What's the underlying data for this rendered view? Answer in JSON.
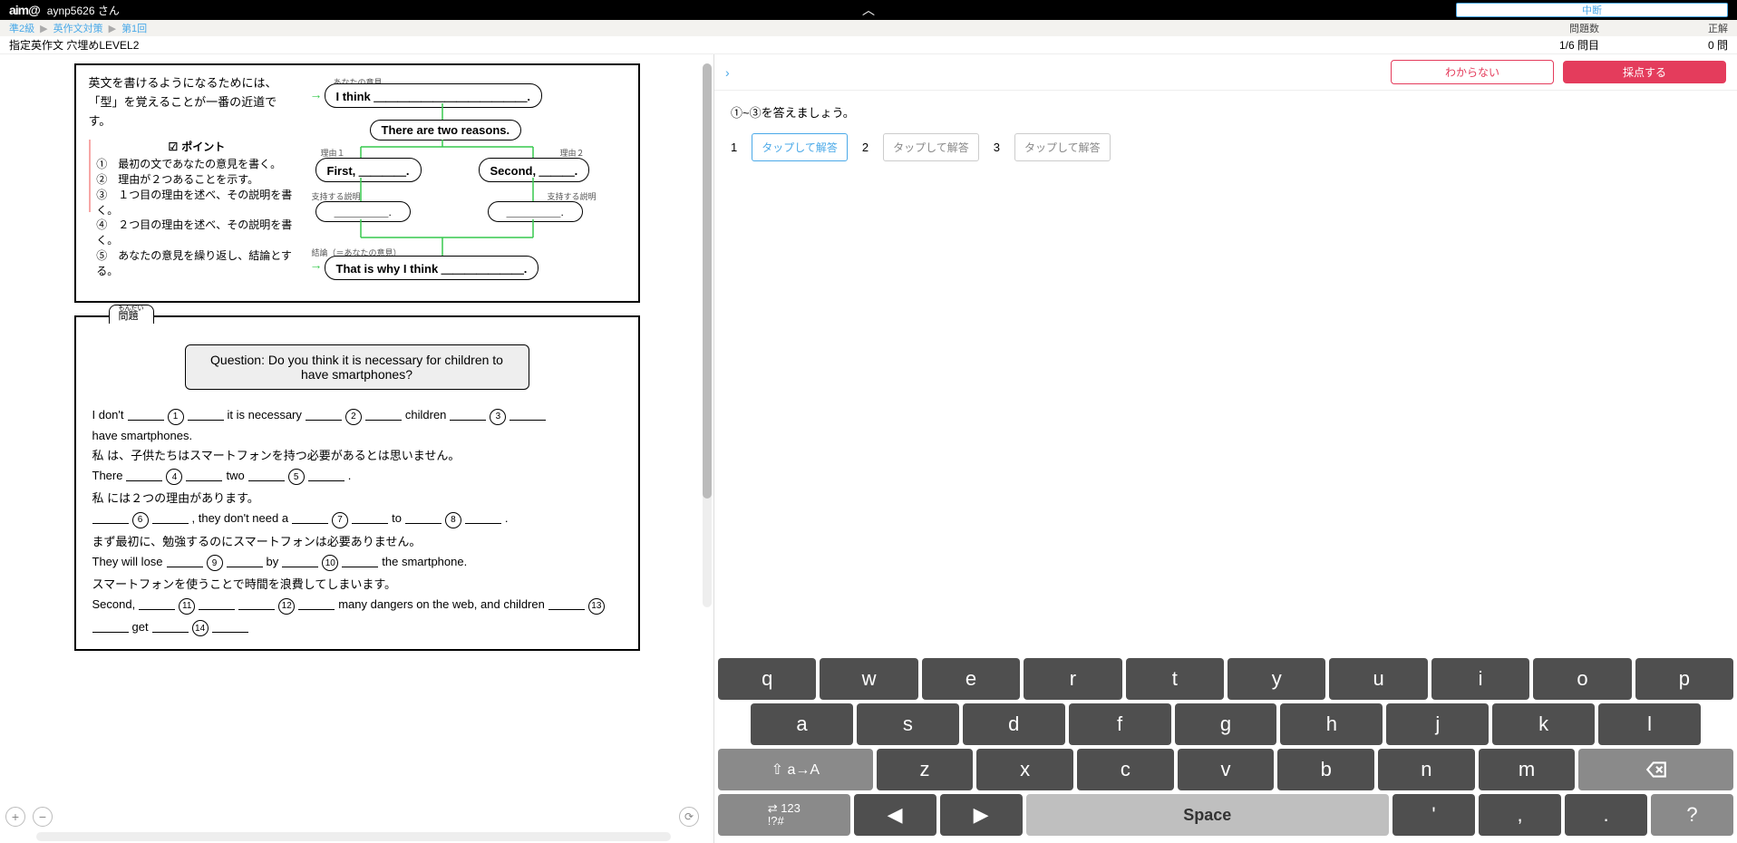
{
  "topbar": {
    "logo": "aim@",
    "user": "aynp5626 さん",
    "interrupt": "中断"
  },
  "breadcrumb": {
    "l1": "準2級",
    "l2": "英作文対策",
    "l3": "第1回",
    "counter_label": "問題数",
    "correct_label": "正解"
  },
  "title": {
    "text": "指定英作文 穴埋めLEVEL2",
    "counter_val": "1/6 問目",
    "correct_val": "0 問"
  },
  "explain": {
    "line1": "英文を書けるようになるためには、",
    "line2": "「型」を覚えることが一番の近道です。",
    "point_h": "ポイント",
    "pts": [
      "①　最初の文であなたの意見を書く。",
      "②　理由が２つあることを示す。",
      "③　１つ目の理由を述べ、その説明を書く。",
      "④　２つ目の理由を述べ、その説明を書く。",
      "⑤　あなたの意見を繰り返し、結論とする。"
    ]
  },
  "flow": {
    "opinion_l": "あなたの意見",
    "b1": "I think ＿＿＿＿＿＿＿＿＿＿＿＿＿.",
    "b2": "There are two reasons.",
    "r1_l": "理由１",
    "r2_l": "理由２",
    "b3": "First, ＿＿＿＿.",
    "b4": "Second, ＿＿＿.",
    "s1_l": "支持する説明",
    "s2_l": "支持する説明",
    "b5": "＿＿＿＿＿.",
    "b6": "＿＿＿＿＿.",
    "concl_l": "結論（＝あなたの意見）",
    "b7": "That is why I think ＿＿＿＿＿＿＿."
  },
  "problem": {
    "tab": "問題",
    "question": "Question:  Do you think it is necessary for children to have smartphones?",
    "l1a": "I don't",
    "l1b": "it is necessary",
    "l1c": "children",
    "l1d": "have smartphones.",
    "l1j": "私 は、子供たちはスマートフォンを持つ必要があるとは思いません。",
    "l2a": "There",
    "l2b": "two",
    "l2c": ".",
    "l2j": "私 には２つの理由があります。",
    "l3a": ", they don't need a",
    "l3b": "to",
    "l3c": ".",
    "l3j": "まず最初に、勉強するのにスマートフォンは必要ありません。",
    "l4a": "They will lose",
    "l4b": "by",
    "l4c": "the smartphone.",
    "l4j": "スマートフォンを使うことで時間を浪費してしまいます。",
    "l5a": "Second,",
    "l5b": "many dangers on the web, and children",
    "l5c": "get"
  },
  "right": {
    "dontknow": "わからない",
    "grade": "採点する",
    "prompt": "①~③を答えましょう。",
    "ans": [
      "1",
      "2",
      "3"
    ],
    "ans_ph": "タップして解答"
  },
  "kb": {
    "r1": [
      "q",
      "w",
      "e",
      "r",
      "t",
      "y",
      "u",
      "i",
      "o",
      "p"
    ],
    "r2": [
      "a",
      "s",
      "d",
      "f",
      "g",
      "h",
      "j",
      "k",
      "l"
    ],
    "shift": "⇧ a→A",
    "r3": [
      "z",
      "x",
      "c",
      "v",
      "b",
      "n",
      "m"
    ],
    "mode": "⇄ 123\n!?#",
    "left": "◀",
    "right": "▶",
    "space": "Space",
    "punct": [
      "'",
      ",",
      ".",
      "?"
    ]
  }
}
